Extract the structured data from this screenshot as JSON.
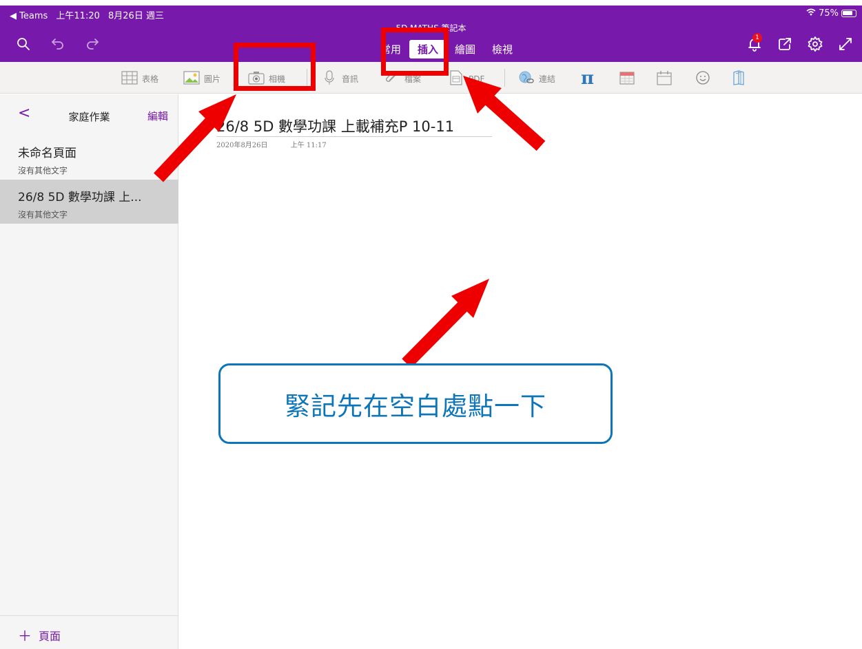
{
  "status_bar": {
    "back_app": "◀ Teams",
    "time": "上午11:20",
    "date": "8月26日 週三",
    "battery": "75%"
  },
  "notebook_title": "5D MATHS 筆記本",
  "toolbar": {
    "left_icons": [
      "search-icon",
      "undo-icon",
      "redo-icon"
    ],
    "right_icons": [
      "bell-icon",
      "share-icon",
      "settings-icon",
      "expand-icon"
    ],
    "notification_count": "1"
  },
  "tabs": [
    {
      "label": "常用",
      "active": false
    },
    {
      "label": "插入",
      "active": true
    },
    {
      "label": "繪圖",
      "active": false
    },
    {
      "label": "檢視",
      "active": false
    }
  ],
  "ribbon": {
    "table": "表格",
    "picture": "圖片",
    "camera": "相機",
    "audio": "音訊",
    "file": "檔案",
    "pdf": "PDF",
    "link": "連結"
  },
  "sidebar": {
    "back": "<",
    "title": "家庭作業",
    "edit": "編輯",
    "pages": [
      {
        "title": "未命名頁面",
        "subtitle": "沒有其他文字",
        "selected": false
      },
      {
        "title": "26/8 5D 數學功課 上...",
        "subtitle": "沒有其他文字",
        "selected": true
      }
    ],
    "add_page": "頁面"
  },
  "page": {
    "title": "26/8 5D 數學功課 上載補充P 10-11",
    "date": "2020年8月26日",
    "time": "上午 11:17"
  },
  "annotation": {
    "callout_text": "緊記先在空白處點一下",
    "arrow_color": "#ee0000",
    "callout_color": "#0e75b8"
  },
  "colors": {
    "accent": "#7719aa"
  }
}
